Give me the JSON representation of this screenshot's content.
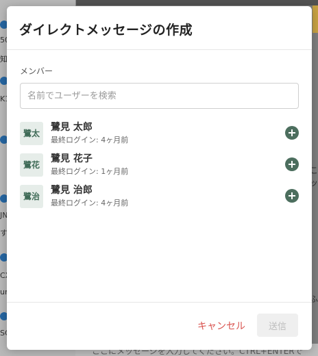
{
  "background": {
    "left_fragments": [
      "50",
      "知",
      "K1",
      "JN",
      "す",
      "CX",
      "ur",
      "SC"
    ],
    "right_fragments": [
      "こ",
      "ッ",
      "ふ"
    ],
    "bottom_text": "ここにメッセージを入力してください。CTRL+ENTERで"
  },
  "modal": {
    "title": "ダイレクトメッセージの作成",
    "members_label": "メンバー",
    "search_placeholder": "名前でユーザーを検索",
    "search_value": "",
    "members": [
      {
        "avatar": "鷺太",
        "name": "鷺見 太郎",
        "last_login": "最終ログイン: 4ヶ月前"
      },
      {
        "avatar": "鷺花",
        "name": "鷺見 花子",
        "last_login": "最終ログイン: 1ヶ月前"
      },
      {
        "avatar": "鷺治",
        "name": "鷺見 治郎",
        "last_login": "最終ログイン: 4ヶ月前"
      }
    ],
    "cancel_label": "キャンセル",
    "send_label": "送信",
    "send_enabled": false
  },
  "colors": {
    "accent_green": "#4c6e5e",
    "cancel_red": "#d9534f",
    "disabled_button_bg": "#efefef"
  },
  "icons": {
    "add_member": "plus-circle-icon"
  }
}
